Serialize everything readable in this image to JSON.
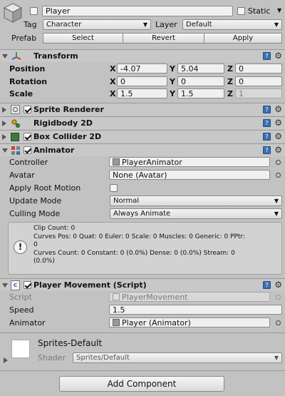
{
  "object": {
    "name": "Player",
    "static_label": "Static",
    "tag_label": "Tag",
    "tag_value": "Character",
    "layer_label": "Layer",
    "layer_value": "Default",
    "prefab_label": "Prefab",
    "prefab_buttons": [
      "Select",
      "Revert",
      "Apply"
    ]
  },
  "transform": {
    "title": "Transform",
    "rows": [
      {
        "label": "Position",
        "x": "-4.07",
        "y": "5.04",
        "z": "0"
      },
      {
        "label": "Rotation",
        "x": "0",
        "y": "0",
        "z": "0"
      },
      {
        "label": "Scale",
        "x": "1.5",
        "y": "1.5",
        "z": "1"
      }
    ],
    "axes": [
      "X",
      "Y",
      "Z"
    ]
  },
  "components": {
    "sprite_renderer": "Sprite Renderer",
    "rigidbody": "Rigidbody 2D",
    "box_collider": "Box Collider 2D"
  },
  "animator": {
    "title": "Animator",
    "controller_label": "Controller",
    "controller_value": "PlayerAnimator",
    "avatar_label": "Avatar",
    "avatar_value": "None (Avatar)",
    "root_motion_label": "Apply Root Motion",
    "update_mode_label": "Update Mode",
    "update_mode_value": "Normal",
    "culling_label": "Culling Mode",
    "culling_value": "Always Animate",
    "info_lines": [
      "Clip Count: 0",
      "Curves Pos: 0 Quat: 0 Euler: 0 Scale: 0 Muscles: 0 Generic: 0 PPtr:",
      "0",
      "Curves Count: 0 Constant: 0 (0.0%) Dense: 0 (0.0%) Stream: 0",
      "(0.0%)"
    ]
  },
  "player_movement": {
    "title": "Player Movement (Script)",
    "script_label": "Script",
    "script_value": "PlayerMovement",
    "speed_label": "Speed",
    "speed_value": "1.5",
    "animator_label": "Animator",
    "animator_value": "Player (Animator)"
  },
  "material": {
    "name": "Sprites-Default",
    "shader_label": "Shader",
    "shader_value": "Sprites/Default"
  },
  "add_component_label": "Add Component"
}
